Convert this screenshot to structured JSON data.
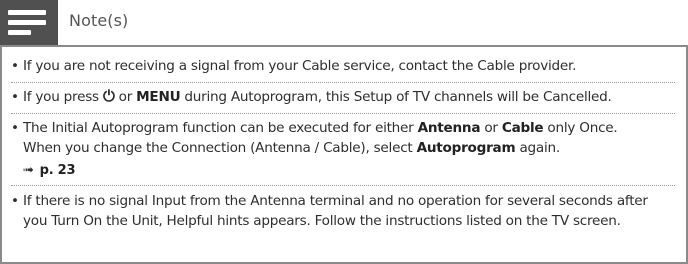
{
  "header": {
    "title": "Note(s)"
  },
  "notes": [
    {
      "text": "If you are not receiving a signal from your Cable service, contact the Cable provider."
    },
    {
      "part1": "If you press ",
      "power_symbol": "⏻",
      "part2": " or ",
      "menu_label": "MENU",
      "part3": " during Autoprogram, this Setup of TV channels will be Cancelled."
    },
    {
      "part1": "The Initial Autoprogram function can be executed for either ",
      "antenna": "Antenna",
      "part2": " or ",
      "cable": "Cable",
      "part3": " only Once.",
      "line2a": "When you change the Connection (Antenna / Cable), select ",
      "autoprogram": "Autoprogram",
      "line2b": " again.",
      "ref_arrow": "➟",
      "page_ref": "p. 23"
    },
    {
      "text": "If there is no signal Input from the Antenna terminal and no operation for several seconds after you Turn On the Unit, Helpful hints appears. Follow the instructions listed on the TV screen."
    }
  ]
}
